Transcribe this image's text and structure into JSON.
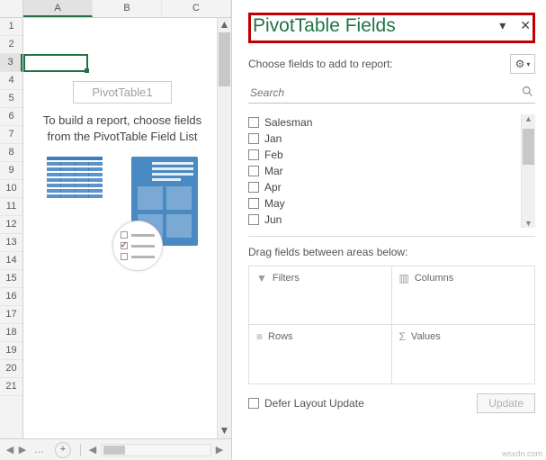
{
  "grid": {
    "columns": [
      "A",
      "B",
      "C"
    ],
    "rows": [
      "1",
      "2",
      "3",
      "4",
      "5",
      "6",
      "7",
      "8",
      "9",
      "10",
      "11",
      "12",
      "13",
      "14",
      "15",
      "16",
      "17",
      "18",
      "19",
      "20",
      "21"
    ],
    "active_cell": "A3"
  },
  "pivot_placeholder": {
    "name": "PivotTable1",
    "message": "To build a report, choose fields from the PivotTable Field List"
  },
  "fields_pane": {
    "title": "PivotTable Fields",
    "subtitle": "Choose fields to add to report:",
    "search_placeholder": "Search",
    "fields": [
      "Salesman",
      "Jan",
      "Feb",
      "Mar",
      "Apr",
      "May",
      "Jun"
    ],
    "areas_label": "Drag fields between areas below:",
    "areas": {
      "filters": "Filters",
      "columns": "Columns",
      "rows": "Rows",
      "values": "Values"
    },
    "defer_label": "Defer Layout Update",
    "update_label": "Update"
  },
  "watermark": "wsxdn.com"
}
